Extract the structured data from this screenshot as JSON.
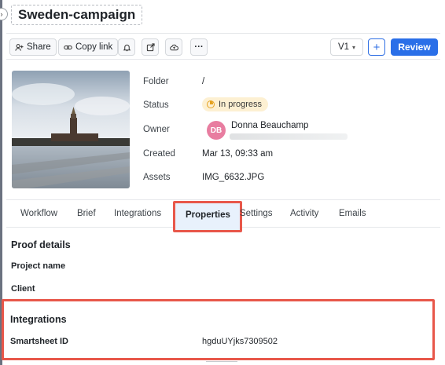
{
  "title": "Sweden-campaign",
  "toolbar": {
    "share_label": "Share",
    "copy_link_label": "Copy link",
    "version_label": "V1",
    "add_label": "+",
    "review_label": "Review"
  },
  "meta": {
    "folder_label": "Folder",
    "folder_value": "/",
    "status_label": "Status",
    "status_value": "In progress",
    "owner_label": "Owner",
    "owner_initials": "DB",
    "owner_name": "Donna Beauchamp",
    "created_label": "Created",
    "created_value": "Mar 13, 09:33 am",
    "assets_label": "Assets",
    "assets_value": "IMG_6632.JPG"
  },
  "tabs": [
    {
      "label": "Workflow"
    },
    {
      "label": "Brief"
    },
    {
      "label": "Integrations"
    },
    {
      "label": "Properties",
      "active": true
    },
    {
      "label": "Settings"
    },
    {
      "label": "Activity"
    },
    {
      "label": "Emails"
    }
  ],
  "proof_details": {
    "title": "Proof details",
    "project_name_label": "Project name",
    "client_label": "Client"
  },
  "integrations": {
    "title": "Integrations",
    "smartsheet_label": "Smartsheet ID",
    "smartsheet_value": "hgduUYjks7309502"
  },
  "colors": {
    "accent": "#2a6fe8",
    "highlight_border": "#e8574a",
    "status_badge_bg": "#fdf0d2",
    "avatar_bg": "#e87da0"
  }
}
